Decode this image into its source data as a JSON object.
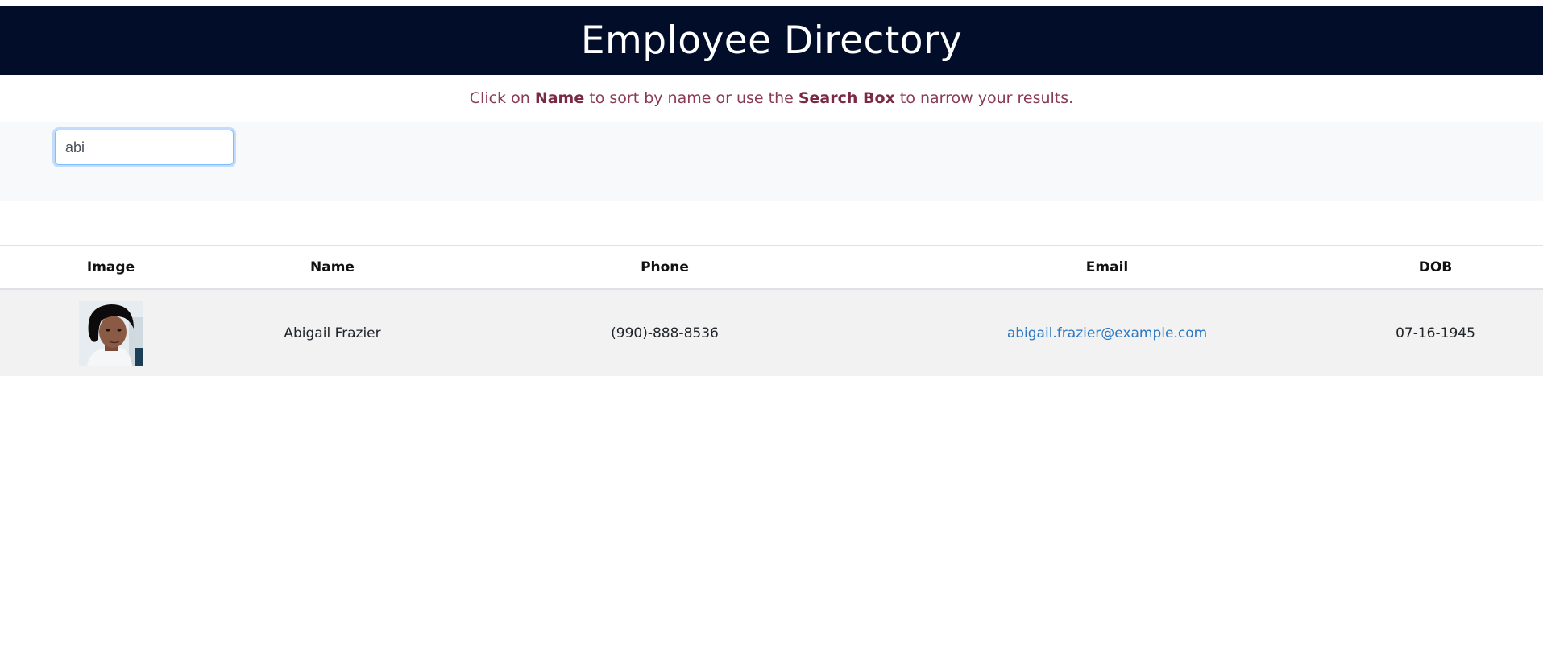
{
  "header": {
    "title": "Employee Directory"
  },
  "instructions": {
    "prefix": "Click on ",
    "name_word": "Name",
    "middle": " to sort by name or use the ",
    "search_word": "Search Box",
    "suffix": " to narrow your results."
  },
  "search": {
    "value": "abi"
  },
  "table": {
    "columns": [
      "Image",
      "Name",
      "Phone",
      "Email",
      "DOB"
    ],
    "rows": [
      {
        "image": "employee-photo",
        "name": "Abigail Frazier",
        "phone": "(990)-888-8536",
        "email": "abigail.frazier@example.com",
        "dob": "07-16-1945"
      }
    ]
  },
  "colors": {
    "header_bg": "#020d2a",
    "instruction_text": "#8a3a52",
    "link": "#2a78c3",
    "row_bg": "#f2f2f2"
  }
}
